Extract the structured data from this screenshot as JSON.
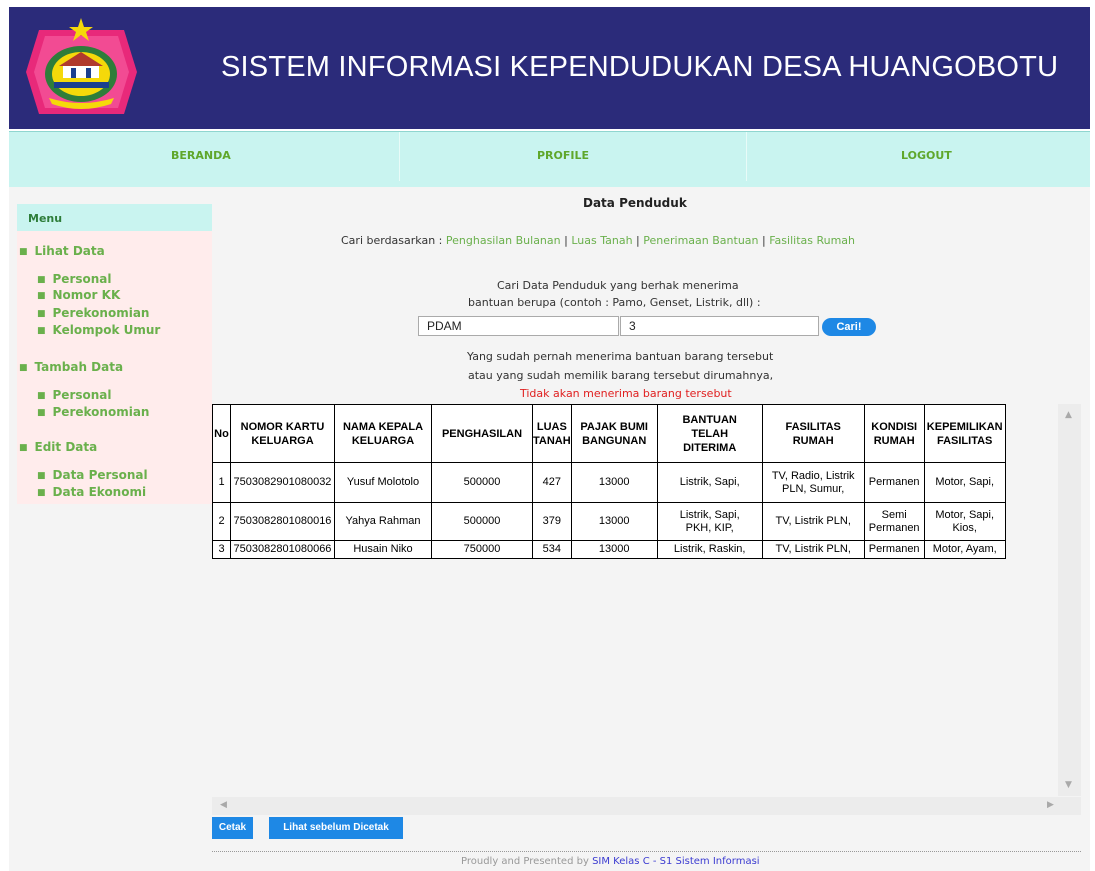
{
  "header": {
    "title": "SISTEM INFORMASI KEPENDUDUKAN DESA HUANGOBOTU",
    "logo_icon": "regency-emblem-icon"
  },
  "nav": {
    "home": "BERANDA",
    "profile": "PROFILE",
    "logout": "LOGOUT"
  },
  "sidebar": {
    "title": "Menu",
    "lihat": {
      "label": "Lihat Data",
      "items": [
        "Personal",
        "Nomor KK",
        "Perekonomian",
        "Kelompok Umur"
      ]
    },
    "tambah": {
      "label": "Tambah Data",
      "items": [
        "Personal",
        "Perekonomian"
      ]
    },
    "edit": {
      "label": "Edit Data",
      "items": [
        "Data Personal",
        "Data Ekonomi"
      ]
    }
  },
  "main": {
    "title": "Data Penduduk",
    "search_by_label": "Cari berdasarkan :",
    "search_links": [
      "Penghasilan Bulanan",
      "Luas Tanah",
      "Penerimaan Bantuan",
      "Fasilitas Rumah"
    ],
    "search_desc_1": "Cari Data Penduduk yang berhak menerima",
    "search_desc_2": "bantuan berupa (contoh : Pamo, Genset, Listrik, dll) :",
    "input1_value": "PDAM",
    "input2_value": "3",
    "search_button": "Cari!",
    "note_1": "Yang sudah pernah menerima bantuan barang tersebut",
    "note_2": "atau yang sudah memilik barang tersebut dirumahnya,",
    "note_red": "Tidak akan menerima barang tersebut"
  },
  "table": {
    "headers": [
      [
        "No"
      ],
      [
        "NOMOR KARTU",
        "KELUARGA"
      ],
      [
        "NAMA KEPALA",
        "KELUARGA"
      ],
      [
        "PENGHASILAN"
      ],
      [
        "LUAS",
        "TANAH"
      ],
      [
        "PAJAK BUMI",
        "BANGUNAN"
      ],
      [
        "BANTUAN",
        "TELAH",
        "DITERIMA"
      ],
      [
        "FASILITAS",
        "RUMAH"
      ],
      [
        "KONDISI",
        "RUMAH"
      ],
      [
        "KEPEMILIKAN",
        "FASILITAS"
      ]
    ],
    "rows": [
      [
        [
          "1"
        ],
        [
          "7503082901080032"
        ],
        [
          "Yusuf Molotolo"
        ],
        [
          "500000"
        ],
        [
          "427"
        ],
        [
          "13000"
        ],
        [
          "Listrik, Sapi,"
        ],
        [
          "TV, Radio, Listrik",
          "PLN, Sumur,"
        ],
        [
          "Permanen"
        ],
        [
          "Motor, Sapi,"
        ]
      ],
      [
        [
          "2"
        ],
        [
          "7503082801080016"
        ],
        [
          "Yahya Rahman"
        ],
        [
          "500000"
        ],
        [
          "379"
        ],
        [
          "13000"
        ],
        [
          "Listrik, Sapi,",
          "PKH, KIP,"
        ],
        [
          "TV, Listrik PLN,"
        ],
        [
          "Semi",
          "Permanen"
        ],
        [
          "Motor, Sapi,",
          "Kios,"
        ]
      ],
      [
        [
          "3"
        ],
        [
          "7503082801080066"
        ],
        [
          "Husain Niko"
        ],
        [
          "750000"
        ],
        [
          "534"
        ],
        [
          "13000"
        ],
        [
          "Listrik, Raskin,"
        ],
        [
          "TV, Listrik PLN,"
        ],
        [
          "Permanen"
        ],
        [
          "Motor, Ayam,"
        ]
      ]
    ]
  },
  "buttons": {
    "print": "Cetak",
    "preview": "Lihat sebelum Dicetak"
  },
  "footer": {
    "prefix": "Proudly and Presented by",
    "link": "SIM Kelas C - S1 Sistem Informasi"
  },
  "colors": {
    "header_bg": "#2b2b7a",
    "nav_bg": "#c9f4f0",
    "link_green": "#6ab04c",
    "button_blue": "#1e88e5",
    "alert_red": "#e02020"
  }
}
